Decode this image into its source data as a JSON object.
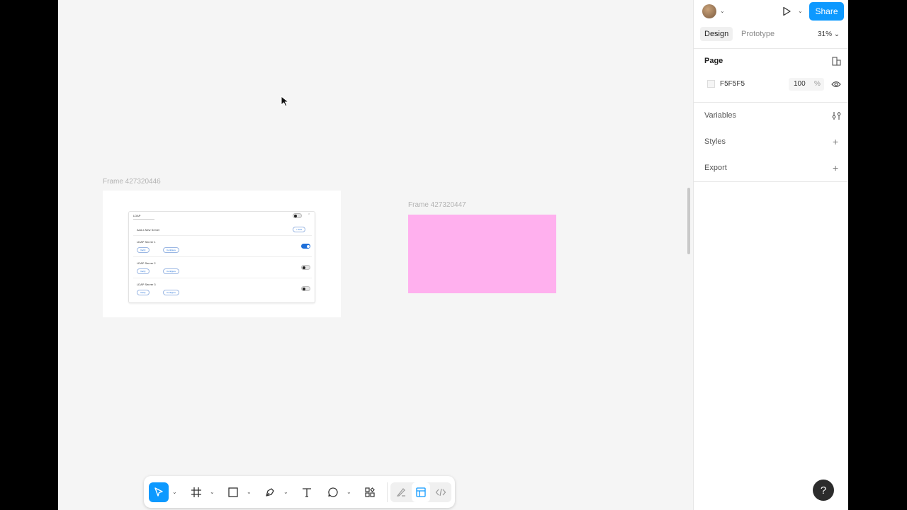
{
  "canvas": {
    "frames": [
      {
        "label": "Frame 427320446"
      },
      {
        "label": "Frame 427320447",
        "fill": "#ffb0ee"
      }
    ],
    "mini_card": {
      "title": "LDAP",
      "add_label": "Add a New Server",
      "add_button": "+ Add",
      "servers": [
        {
          "name": "LDAP Server 1",
          "verify": "Verify",
          "configure": "Configure",
          "enabled": true
        },
        {
          "name": "LDAP Server 2",
          "verify": "Verify",
          "configure": "Configure",
          "enabled": false
        },
        {
          "name": "LDAP Server 3",
          "verify": "Verify",
          "configure": "Configure",
          "enabled": false
        }
      ]
    }
  },
  "toolbar": {
    "tools": [
      "move-icon",
      "frame-icon",
      "rectangle-icon",
      "pen-icon",
      "text-icon",
      "comment-icon",
      "actions-icon"
    ],
    "modes": [
      "draw-mode-icon",
      "design-mode-icon",
      "dev-mode-icon"
    ],
    "active_tool": "move-icon",
    "accent": "#0d99ff"
  },
  "panel": {
    "share_label": "Share",
    "tabs": {
      "design": "Design",
      "prototype": "Prototype"
    },
    "zoom": "31%",
    "page": {
      "title": "Page",
      "color_hex": "F5F5F5",
      "opacity": "100",
      "opacity_unit": "%"
    },
    "variables": "Variables",
    "styles": "Styles",
    "export": "Export"
  },
  "help_label": "?"
}
